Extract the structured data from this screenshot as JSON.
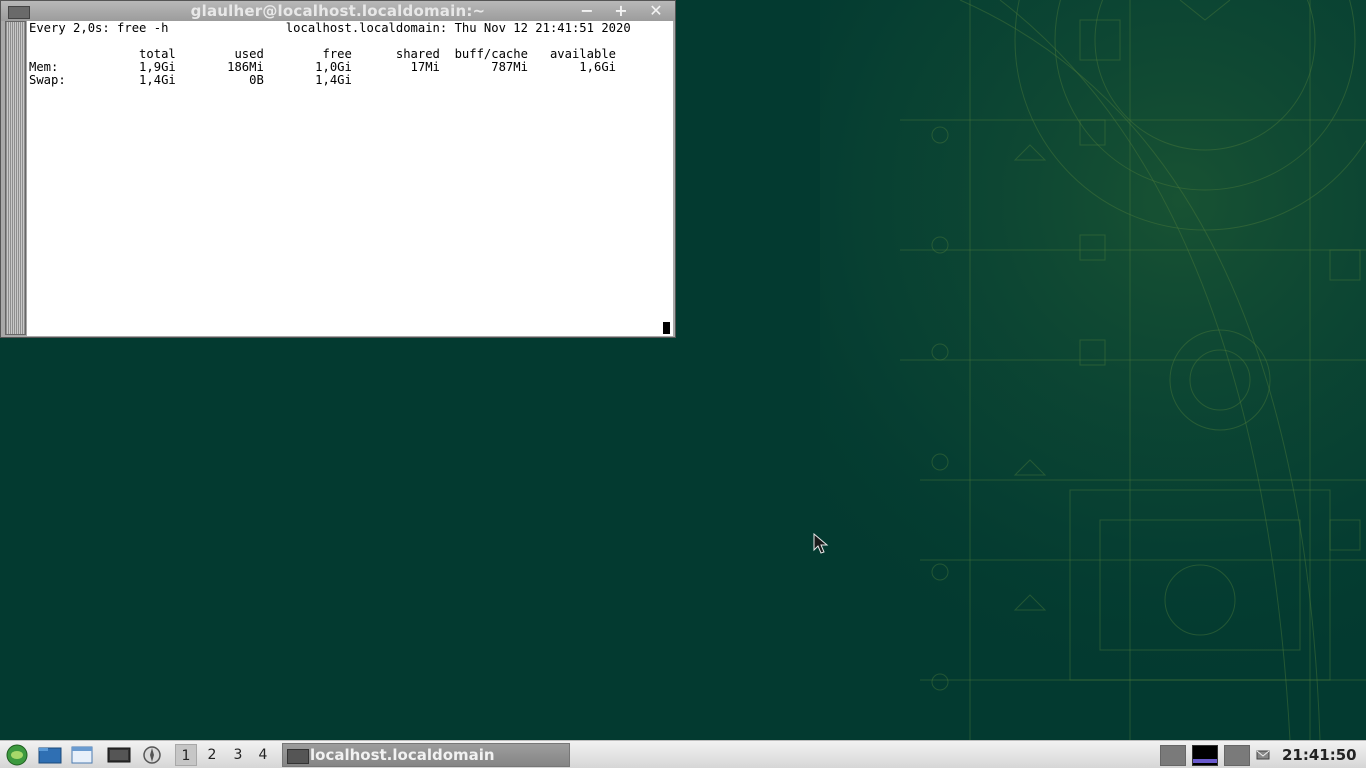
{
  "window": {
    "title": "glaulher@localhost.localdomain:~",
    "minimize_glyph": "−",
    "maximize_glyph": "+",
    "close_glyph": "✕"
  },
  "terminal": {
    "lines": [
      "Every 2,0s: free -h                localhost.localdomain: Thu Nov 12 21:41:51 2020",
      "",
      "               total        used        free      shared  buff/cache   available",
      "Mem:           1,9Gi       186Mi       1,0Gi        17Mi       787Mi       1,6Gi",
      "Swap:          1,4Gi          0B       1,4Gi"
    ]
  },
  "taskbar": {
    "desktops": [
      "1",
      "2",
      "3",
      "4"
    ],
    "active_desktop": "1",
    "task_label": "localhost.localdomain",
    "clock": "21:41:50",
    "icons": [
      "menu-icon",
      "file-manager-icon",
      "show-desktop-icon",
      "terminal-icon",
      "browser-icon"
    ]
  },
  "colors": {
    "desktop": "#033a30",
    "terminal_bg": "#ffffff",
    "accent": "#6a5acd"
  }
}
